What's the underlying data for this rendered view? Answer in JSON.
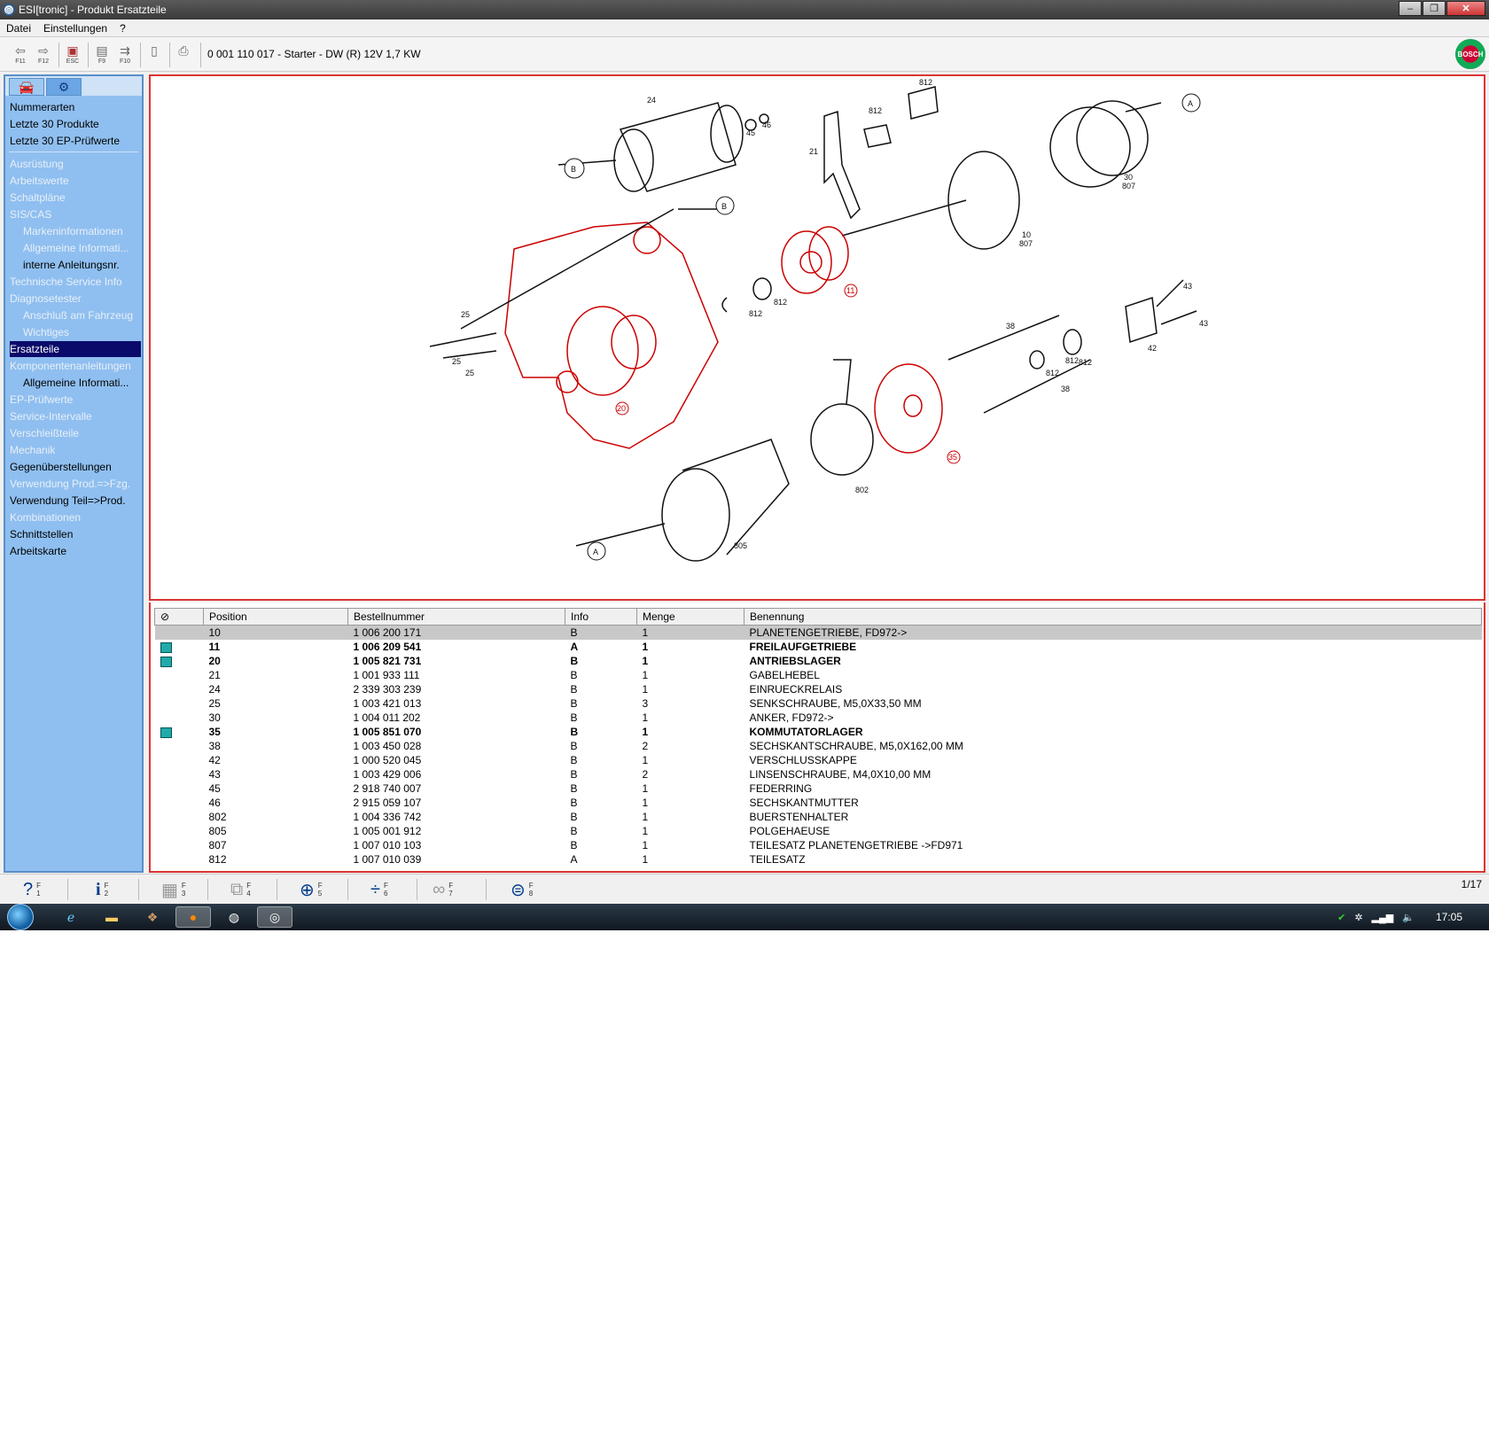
{
  "window": {
    "title": "ESI[tronic] - Produkt Ersatzteile",
    "buttons": [
      "–",
      "❐",
      "✕"
    ]
  },
  "menu": [
    "Datei",
    "Einstellungen",
    "?"
  ],
  "toolbar": {
    "buttons": [
      {
        "icon": "arrow-back-icon",
        "label": "F11"
      },
      {
        "icon": "arrow-forward-icon",
        "label": "F12"
      },
      {
        "icon": "escape-icon",
        "label": "ESC"
      },
      {
        "icon": "f9-icon",
        "label": "F9"
      },
      {
        "icon": "f10-icon",
        "label": "F10"
      },
      {
        "icon": "document-icon",
        "label": ""
      },
      {
        "icon": "print-icon",
        "label": ""
      }
    ],
    "product_title": "0 001 110 017 - Starter - DW (R) 12V 1,7 KW"
  },
  "sidebar": {
    "items": [
      {
        "label": "Nummerarten",
        "enabled": true,
        "sub": false
      },
      {
        "label": "Letzte 30 Produkte",
        "enabled": true,
        "sub": false
      },
      {
        "label": "Letzte 30 EP-Prüfwerte",
        "enabled": true,
        "sub": false
      },
      {
        "label": "Ausrüstung",
        "enabled": false,
        "sub": false
      },
      {
        "label": "Arbeitswerte",
        "enabled": false,
        "sub": false
      },
      {
        "label": "Schaltpläne",
        "enabled": false,
        "sub": false
      },
      {
        "label": "SIS/CAS",
        "enabled": false,
        "sub": false
      },
      {
        "label": "Markeninformationen",
        "enabled": false,
        "sub": true
      },
      {
        "label": "Allgemeine Informati...",
        "enabled": false,
        "sub": true
      },
      {
        "label": "interne Anleitungsnr.",
        "enabled": true,
        "sub": true
      },
      {
        "label": "Technische Service Info",
        "enabled": false,
        "sub": false
      },
      {
        "label": "Diagnosetester",
        "enabled": false,
        "sub": false
      },
      {
        "label": "Anschluß am Fahrzeug",
        "enabled": false,
        "sub": true
      },
      {
        "label": "Wichtiges",
        "enabled": false,
        "sub": true
      },
      {
        "label": "Ersatzteile",
        "enabled": true,
        "sub": false,
        "selected": true
      },
      {
        "label": "Komponentenanleitungen",
        "enabled": false,
        "sub": false
      },
      {
        "label": "Allgemeine Informati...",
        "enabled": true,
        "sub": true
      },
      {
        "label": "EP-Prüfwerte",
        "enabled": false,
        "sub": false
      },
      {
        "label": "Service-Intervalle",
        "enabled": false,
        "sub": false
      },
      {
        "label": "Verschleißteile",
        "enabled": false,
        "sub": false
      },
      {
        "label": "Mechanik",
        "enabled": false,
        "sub": false
      },
      {
        "label": "Gegenüberstellungen",
        "enabled": true,
        "sub": false
      },
      {
        "label": "Verwendung Prod.=>Fzg.",
        "enabled": false,
        "sub": false
      },
      {
        "label": "Verwendung Teil=>Prod.",
        "enabled": true,
        "sub": false
      },
      {
        "label": "Kombinationen",
        "enabled": false,
        "sub": false
      },
      {
        "label": "Schnittstellen",
        "enabled": true,
        "sub": false
      },
      {
        "label": "Arbeitskarte",
        "enabled": true,
        "sub": false
      }
    ]
  },
  "diagram": {
    "labels": [
      "24",
      "45",
      "46",
      "812",
      "812",
      "21",
      "A",
      "B",
      "B",
      "30",
      "807",
      "10",
      "807",
      "11",
      "812",
      "812",
      "25",
      "25",
      "25",
      "20",
      "38",
      "43",
      "43",
      "42",
      "812",
      "812",
      "812",
      "38",
      "35",
      "802",
      "805",
      "A"
    ]
  },
  "table": {
    "columns": [
      "Position",
      "Bestellnummer",
      "Info",
      "Menge",
      "Benennung"
    ],
    "rows": [
      {
        "pos": "10",
        "nr": "1 006 200 171",
        "info": "B",
        "menge": "1",
        "name": "PLANETENGETRIEBE,   FD972->",
        "icon": false,
        "bold": false
      },
      {
        "pos": "11",
        "nr": "1 006 209 541",
        "info": "A",
        "menge": "1",
        "name": "FREILAUFGETRIEBE",
        "icon": true,
        "bold": true
      },
      {
        "pos": "20",
        "nr": "1 005 821 731",
        "info": "B",
        "menge": "1",
        "name": "ANTRIEBSLAGER",
        "icon": true,
        "bold": true
      },
      {
        "pos": "21",
        "nr": "1 001 933 111",
        "info": "B",
        "menge": "1",
        "name": "GABELHEBEL",
        "icon": false,
        "bold": false
      },
      {
        "pos": "24",
        "nr": "2 339 303 239",
        "info": "B",
        "menge": "1",
        "name": "EINRUECKRELAIS",
        "icon": false,
        "bold": false
      },
      {
        "pos": "25",
        "nr": "1 003 421 013",
        "info": "B",
        "menge": "3",
        "name": "SENKSCHRAUBE,   M5,0X33,50 MM",
        "icon": false,
        "bold": false
      },
      {
        "pos": "30",
        "nr": "1 004 011 202",
        "info": "B",
        "menge": "1",
        "name": "ANKER,   FD972->",
        "icon": false,
        "bold": false
      },
      {
        "pos": "35",
        "nr": "1 005 851 070",
        "info": "B",
        "menge": "1",
        "name": "KOMMUTATORLAGER",
        "icon": true,
        "bold": true
      },
      {
        "pos": "38",
        "nr": "1 003 450 028",
        "info": "B",
        "menge": "2",
        "name": "SECHSKANTSCHRAUBE,   M5,0X162,00 MM",
        "icon": false,
        "bold": false
      },
      {
        "pos": "42",
        "nr": "1 000 520 045",
        "info": "B",
        "menge": "1",
        "name": "VERSCHLUSSKAPPE",
        "icon": false,
        "bold": false
      },
      {
        "pos": "43",
        "nr": "1 003 429 006",
        "info": "B",
        "menge": "2",
        "name": "LINSENSCHRAUBE,   M4,0X10,00 MM",
        "icon": false,
        "bold": false
      },
      {
        "pos": "45",
        "nr": "2 918 740 007",
        "info": "B",
        "menge": "1",
        "name": "FEDERRING",
        "icon": false,
        "bold": false
      },
      {
        "pos": "46",
        "nr": "2 915 059 107",
        "info": "B",
        "menge": "1",
        "name": "SECHSKANTMUTTER",
        "icon": false,
        "bold": false
      },
      {
        "pos": "802",
        "nr": "1 004 336 742",
        "info": "B",
        "menge": "1",
        "name": "BUERSTENHALTER",
        "icon": false,
        "bold": false
      },
      {
        "pos": "805",
        "nr": "1 005 001 912",
        "info": "B",
        "menge": "1",
        "name": "POLGEHAEUSE",
        "icon": false,
        "bold": false
      },
      {
        "pos": "807",
        "nr": "1 007 010 103",
        "info": "B",
        "menge": "1",
        "name": "TEILESATZ PLANETENGETRIEBE   ->FD971",
        "icon": false,
        "bold": false
      },
      {
        "pos": "812",
        "nr": "1 007 010 039",
        "info": "A",
        "menge": "1",
        "name": "TEILESATZ",
        "icon": false,
        "bold": false
      }
    ]
  },
  "function_bar": {
    "keys": [
      {
        "icon": "help-icon",
        "glyph": "?",
        "f": "F",
        "n": "1",
        "enabled": true
      },
      {
        "icon": "info-icon",
        "glyph": "i",
        "f": "F",
        "n": "2",
        "enabled": true
      },
      {
        "icon": "calculator-icon",
        "glyph": "▦",
        "f": "F",
        "n": "3",
        "enabled": false
      },
      {
        "icon": "compare-icon",
        "glyph": "⧉",
        "f": "F",
        "n": "4",
        "enabled": false
      },
      {
        "icon": "zoom-icon",
        "glyph": "⊕",
        "f": "F",
        "n": "5",
        "enabled": true
      },
      {
        "icon": "split-icon",
        "glyph": "÷",
        "f": "F",
        "n": "6",
        "enabled": true
      },
      {
        "icon": "group-icon",
        "glyph": "∞",
        "f": "F",
        "n": "7",
        "enabled": false
      },
      {
        "icon": "bosch-icon",
        "glyph": "⊜",
        "f": "F",
        "n": "8",
        "enabled": true
      }
    ],
    "pager": "1/17"
  },
  "taskbar": {
    "apps": [
      "ie-icon",
      "folder-icon",
      "app-icon",
      "firefox-icon",
      "steam-icon",
      "esitronic-icon"
    ],
    "clock": "17:05"
  }
}
